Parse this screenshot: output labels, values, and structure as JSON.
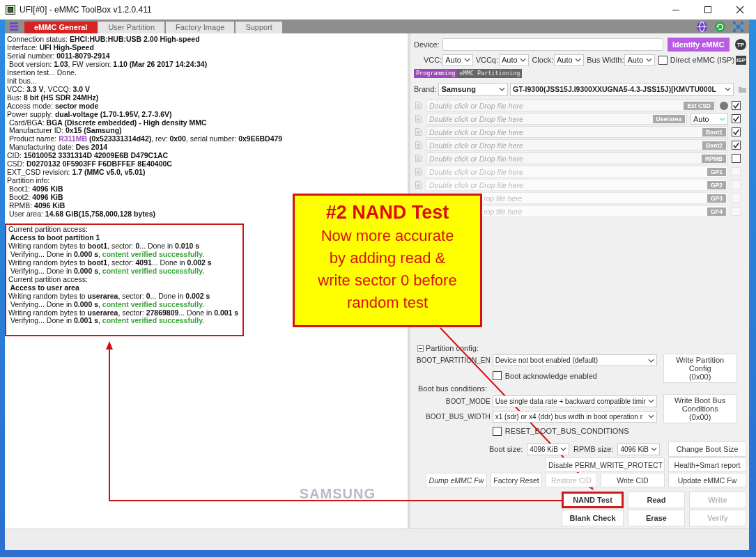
{
  "window": {
    "title": "UFI[#0] - eMMC ToolBox v1.2.0.411"
  },
  "tabs": [
    {
      "label": "eMMC General",
      "selected": true
    },
    {
      "label": "User Partition",
      "selected": false
    },
    {
      "label": "Factory Image",
      "selected": false
    },
    {
      "label": "Support",
      "selected": false
    }
  ],
  "log": {
    "lines": [
      [
        {
          "text": "Connection status: "
        },
        {
          "text": "EHCI:HUB:HUB:USB 2.00 High-speed",
          "kind": "value"
        }
      ],
      [
        {
          "text": "Interface: "
        },
        {
          "text": "UFI High-Speed",
          "kind": "value"
        }
      ],
      [
        {
          "text": "Serial number: "
        },
        {
          "text": "0011-8079-2914",
          "kind": "value"
        }
      ],
      [
        {
          "text": " Boot version: "
        },
        {
          "text": "1.03",
          "kind": "value"
        },
        {
          "text": ", FW version: "
        },
        {
          "text": "1.10 (Mar 26 2017 14:24:34)",
          "kind": "value"
        }
      ],
      [
        {
          "text": "Insertion test... Done."
        }
      ],
      [
        {
          "text": "Init bus..."
        }
      ],
      [
        {
          "text": "VCC: "
        },
        {
          "text": "3.3 V",
          "kind": "value"
        },
        {
          "text": ", VCCQ: "
        },
        {
          "text": "3.0 V",
          "kind": "value"
        }
      ],
      [
        {
          "text": "Bus: "
        },
        {
          "text": "8 bit (HS SDR 24MHz)",
          "kind": "value"
        }
      ],
      [
        {
          "text": "Access mode: "
        },
        {
          "text": "sector mode",
          "kind": "value"
        }
      ],
      [
        {
          "text": "Power supply: "
        },
        {
          "text": "dual-voltage (1.70-1.95V, 2.7-3.6V)",
          "kind": "value"
        }
      ],
      [
        {
          "text": " Card/BGA: "
        },
        {
          "text": "BGA (Discrete embedded) - High density MMC",
          "kind": "value"
        }
      ],
      [
        {
          "text": " Manufacturer ID: "
        },
        {
          "text": "0x15 (Samsung)",
          "kind": "value"
        }
      ],
      [
        {
          "text": " Product name: "
        },
        {
          "text": "R311MB",
          "kind": "product"
        },
        {
          "text": " (0x523331314d42)",
          "kind": "value"
        },
        {
          "text": ", rev: "
        },
        {
          "text": "0x00",
          "kind": "value"
        },
        {
          "text": ", serial number: "
        },
        {
          "text": "0x9E6BD479",
          "kind": "value"
        }
      ],
      [
        {
          "text": " Manufacturing date: "
        },
        {
          "text": "Des 2014",
          "kind": "value"
        }
      ],
      [
        {
          "text": "CID: "
        },
        {
          "text": "15010052 3331314D 42009E6B D479C1AC",
          "kind": "value"
        }
      ],
      [
        {
          "text": "CSD: "
        },
        {
          "text": "D0270132 0F5903FF F6DBFFEF 8E40400C",
          "kind": "value"
        }
      ],
      [
        {
          "text": "EXT_CSD revision: "
        },
        {
          "text": "1.7 (MMC v5.0, v5.01)",
          "kind": "value"
        }
      ],
      [
        {
          "text": "Partition info:"
        }
      ],
      [
        {
          "text": " Boot1: "
        },
        {
          "text": "4096 KiB",
          "kind": "value"
        }
      ],
      [
        {
          "text": " Boot2: "
        },
        {
          "text": "4096 KiB",
          "kind": "value"
        }
      ],
      [
        {
          "text": " RPMB: "
        },
        {
          "text": "4096 KiB",
          "kind": "value"
        }
      ],
      [
        {
          "text": " User area: "
        },
        {
          "text": "14.68 GiB(15,758,000,128 bytes)",
          "kind": "value"
        }
      ]
    ],
    "highlighted_lines": [
      [
        {
          "text": "Current partition access:"
        }
      ],
      [
        {
          "text": " Access to boot partition 1",
          "kind": "value"
        }
      ],
      [
        {
          "text": "Writing random bytes to "
        },
        {
          "text": "boot1",
          "kind": "value"
        },
        {
          "text": ", sector: "
        },
        {
          "text": "0",
          "kind": "value"
        },
        {
          "text": "... Done in "
        },
        {
          "text": "0.010 s",
          "kind": "value"
        }
      ],
      [
        {
          "text": " Verifying... Done in "
        },
        {
          "text": "0.000 s",
          "kind": "value"
        },
        {
          "text": ", "
        },
        {
          "text": "content verified successfully.",
          "kind": "success"
        }
      ],
      [
        {
          "text": "Writing random bytes to "
        },
        {
          "text": "boot1",
          "kind": "value"
        },
        {
          "text": ", sector: "
        },
        {
          "text": "4091",
          "kind": "value"
        },
        {
          "text": "... Done in "
        },
        {
          "text": "0.002 s",
          "kind": "value"
        }
      ],
      [
        {
          "text": " Verifying... Done in "
        },
        {
          "text": "0.000 s",
          "kind": "value"
        },
        {
          "text": ", "
        },
        {
          "text": "content verified successfully.",
          "kind": "success"
        }
      ],
      [
        {
          "text": "Current partition access:"
        }
      ],
      [
        {
          "text": " Access to user area",
          "kind": "value"
        }
      ],
      [
        {
          "text": "Writing random bytes to "
        },
        {
          "text": "userarea",
          "kind": "value"
        },
        {
          "text": ", sector: "
        },
        {
          "text": "0",
          "kind": "value"
        },
        {
          "text": "... Done in "
        },
        {
          "text": "0.002 s",
          "kind": "value"
        }
      ],
      [
        {
          "text": " Verifying... Done in "
        },
        {
          "text": "0.000 s",
          "kind": "value"
        },
        {
          "text": ", "
        },
        {
          "text": "content verified successfully.",
          "kind": "success"
        }
      ],
      [
        {
          "text": "Writing random bytes to "
        },
        {
          "text": "userarea",
          "kind": "value"
        },
        {
          "text": ", sector: "
        },
        {
          "text": "27869809",
          "kind": "value"
        },
        {
          "text": "... Done in "
        },
        {
          "text": "0.001 s",
          "kind": "value"
        }
      ],
      [
        {
          "text": " Verifying... Done in "
        },
        {
          "text": "0.001 s",
          "kind": "value"
        },
        {
          "text": ", "
        },
        {
          "text": "content verified successfully.",
          "kind": "success"
        }
      ]
    ],
    "logo": "SAMSUNG"
  },
  "device": {
    "label": "Device:",
    "identify_button": "Identify eMMC",
    "badge": "TP"
  },
  "power": [
    {
      "label": "VCC:",
      "value": "Auto"
    },
    {
      "label": "VCCq:",
      "value": "Auto"
    },
    {
      "label": "Clock:",
      "value": "Auto"
    },
    {
      "label": "Bus Width:",
      "value": "Auto"
    }
  ],
  "direct_emmc": {
    "label": "Direct eMMC (ISP)",
    "checked": false,
    "badge": "ISP"
  },
  "mode_tabs": [
    {
      "label": "Programming",
      "selected": true
    },
    {
      "label": "eMMC Partitioning",
      "selected": false
    }
  ],
  "brand": {
    "label": "Brand:",
    "value": "Samsung",
    "model": "GT-I9300(JSS15J.I9300XXUGNA5-4.3-JSS15J)[KMVTU000L"
  },
  "files": [
    {
      "placeholder": "Double click or Drop file here",
      "tag": "Ext CSD",
      "kind": "dot",
      "checked": true,
      "disabled": false,
      "covered": false
    },
    {
      "placeholder": "Double click or Drop file here",
      "tag": "Userarea",
      "kind": "select",
      "option": "Auto",
      "checked": true,
      "disabled": false,
      "covered": false
    },
    {
      "placeholder": "Double click or Drop file here",
      "tag": "Boot1",
      "kind": "plain",
      "checked": true,
      "disabled": false,
      "covered": false
    },
    {
      "placeholder": "Double click or Drop file here",
      "tag": "Boot2",
      "kind": "plain",
      "checked": true,
      "disabled": false,
      "covered": false
    },
    {
      "placeholder": "Double click or Drop file here",
      "tag": "RPMB",
      "kind": "plain",
      "checked": false,
      "disabled": false,
      "covered": false
    },
    {
      "placeholder": "Double click or Drop file here",
      "tag": "GP1",
      "kind": "plain",
      "checked": false,
      "disabled": true,
      "covered": false
    },
    {
      "placeholder": "Double click or Drop file here",
      "tag": "GP2",
      "kind": "plain",
      "checked": false,
      "disabled": true,
      "covered": false
    },
    {
      "placeholder": "rop file here",
      "tag": "GP3",
      "kind": "plain",
      "checked": false,
      "disabled": true,
      "covered": true
    },
    {
      "placeholder": "rop file here",
      "tag": "GP4",
      "kind": "plain",
      "checked": false,
      "disabled": true,
      "covered": true
    }
  ],
  "partition_config": {
    "title": "Partition config:",
    "expanded": true,
    "boot_partition": {
      "label": "BOOT_PARTITION_EN",
      "value": "Device not boot enabled (default)"
    },
    "boot_ack": {
      "label": "Boot acknowledge enabled",
      "checked": false
    },
    "write_config_button": [
      "Write Partition Config",
      "(0x00)"
    ],
    "bus_title": "Boot bus conditions:",
    "boot_mode": {
      "label": "BOOT_MODE",
      "value": "Use single data rate + backward compatible timir"
    },
    "boot_bus_width": {
      "label": "BOOT_BUS_WIDTH",
      "value": "x1 (sdr) or x4 (ddr) bus width in boot operation r"
    },
    "write_bus_button": [
      "Write Boot Bus Conditions",
      "(0x00)"
    ],
    "reset": {
      "label": "RESET_BOOT_BUS_CONDITIONS",
      "checked": false
    },
    "boot_size": {
      "label": "Boot size:",
      "value": "4096 KiB"
    },
    "rpmb_size": {
      "label": "RPMB size:",
      "value": "4096 KiB"
    },
    "change_button": "Change Boot Size"
  },
  "tool_rows": [
    [
      {
        "label": "Disable PERM_WRITE_PROTECT",
        "disabled": false,
        "italic": false
      },
      {
        "label": "Health+Smart report",
        "disabled": false,
        "italic": false
      }
    ],
    [
      {
        "label": "Dump eMMC Fw",
        "disabled": false,
        "italic": true
      },
      {
        "label": "Factory Reset",
        "disabled": false,
        "italic": false
      },
      {
        "label": "Restore CID",
        "disabled": true,
        "italic": false
      },
      {
        "label": "Write CID",
        "disabled": false,
        "italic": false
      },
      {
        "label": "Update eMMC Fw",
        "disabled": false,
        "italic": false
      }
    ]
  ],
  "main_buttons": [
    {
      "label": "NAND Test",
      "disabled": false,
      "highlighted": true
    },
    {
      "label": "Read",
      "disabled": false,
      "highlighted": false
    },
    {
      "label": "Write",
      "disabled": true,
      "highlighted": false
    },
    {
      "label": "Blank Check",
      "disabled": false,
      "highlighted": false
    },
    {
      "label": "Erase",
      "disabled": false,
      "highlighted": false
    },
    {
      "label": "Verify",
      "disabled": true,
      "highlighted": false
    }
  ],
  "callout": {
    "title": "#2 NAND Test",
    "lines": [
      "Now more accurate",
      "by adding read &",
      "write sector 0 before",
      "random test"
    ]
  }
}
